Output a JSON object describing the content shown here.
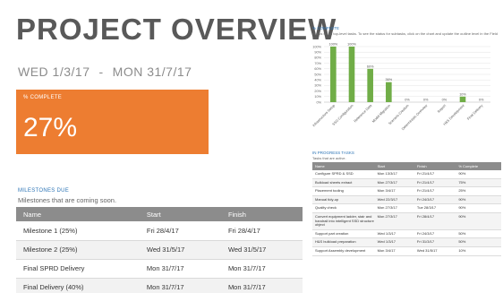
{
  "header": {
    "title": "PROJECT OVERVIEW",
    "start_date": "WED 1/3/17",
    "separator": "-",
    "end_date": "MON 31/7/17"
  },
  "kpi": {
    "label": "% COMPLETE",
    "value": "27%",
    "color": "#ed7d31"
  },
  "milestones": {
    "heading": "MILESTONES DUE",
    "subtitle": "Milestones that are coming soon.",
    "columns": [
      "Name",
      "Start",
      "Finish"
    ],
    "rows": [
      [
        "Milestone 1 (25%)",
        "Fri 28/4/17",
        "Fri 28/4/17"
      ],
      [
        "Milestone 2 (25%)",
        "Wed 31/5/17",
        "Wed 31/5/17"
      ],
      [
        "Final SPRD Delivery",
        "Mon 31/7/17",
        "Mon 31/7/17"
      ],
      [
        "Final Delivery (40%)",
        "Mon 31/7/17",
        "Mon 31/7/17"
      ]
    ]
  },
  "percent_complete_panel": {
    "heading": "% COMPLETE",
    "subtitle": "Status for all top-level tasks. To see the status for subtasks, click on the chart and update the outline level in the Field List."
  },
  "chart_data": {
    "type": "bar",
    "categories": [
      "Infrastructure Setup",
      "SSD Configuration",
      "Reference Data",
      "Model Migration",
      "Scenario Creation",
      "Deterministic Overview",
      "Report",
      "H&S Development",
      "Final Delivery"
    ],
    "values": [
      100,
      100,
      60,
      36,
      0,
      0,
      0,
      10,
      0
    ],
    "data_labels": [
      "100%",
      "100%",
      "60%",
      "36%",
      "0%",
      "0%",
      "0%",
      "10%",
      "0%"
    ],
    "ylim": [
      0,
      100
    ],
    "yticks": [
      "0%",
      "10%",
      "20%",
      "30%",
      "40%",
      "50%",
      "60%",
      "70%",
      "80%",
      "90%",
      "100%"
    ],
    "bar_color": "#70ad47",
    "grid": true
  },
  "in_progress": {
    "heading": "IN PROGRESS TASKS",
    "subtitle": "Tasks that are active.",
    "columns": [
      "Name",
      "Start",
      "Finish",
      "% Complete"
    ],
    "rows": [
      [
        "Configure SPRD & SSD",
        "Mon 13/3/17",
        "Fri 21/4/17",
        "90%"
      ],
      [
        "Bulkload sheets extract",
        "Mon 27/3/17",
        "Fri 21/4/17",
        "75%"
      ],
      [
        "Placement tooling",
        "Mon 3/4/17",
        "Fri 21/4/17",
        "25%"
      ],
      [
        "Manual tidy-up",
        "Wed 22/3/17",
        "Fri 24/3/17",
        "90%"
      ],
      [
        "Quality check",
        "Mon 27/3/17",
        "Tue 28/3/17",
        "90%"
      ],
      [
        "Convert equipment ladder, stair and handrail into intelligent SSD structure object",
        "Mon 27/3/17",
        "Fri 28/4/17",
        "90%"
      ],
      [
        "Support part creation",
        "Wed 1/3/17",
        "Fri 24/3/17",
        "50%"
      ],
      [
        "H&S bulkload preparation",
        "Wed 1/3/17",
        "Fri 31/3/17",
        "50%"
      ],
      [
        "Support Assembly development",
        "Mon 3/4/17",
        "Wed 31/5/17",
        "10%"
      ]
    ]
  }
}
